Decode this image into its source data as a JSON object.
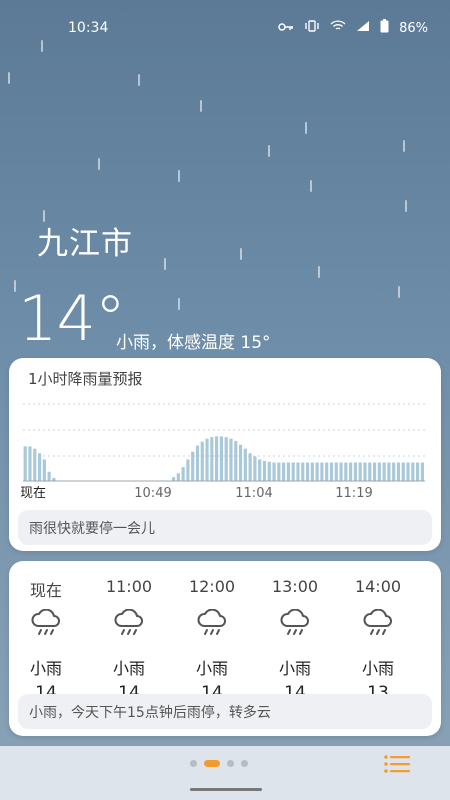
{
  "status_bar": {
    "time": "10:34",
    "battery": "86%",
    "icons": [
      "key-icon",
      "vibrate-icon",
      "wifi-icon",
      "signal-icon",
      "battery-icon"
    ]
  },
  "location": {
    "city": "九江市"
  },
  "current": {
    "temperature": "14°",
    "summary": "小雨，体感温度 15°"
  },
  "precip_card": {
    "title": "1小时降雨量预报",
    "time_labels": [
      "现在",
      "10:49",
      "11:04",
      "11:19"
    ],
    "note": "雨很快就要停一会儿",
    "chart_data": {
      "type": "bar",
      "title": "1小时降雨量预报",
      "x": [
        "现在",
        "10:49",
        "11:04",
        "11:19"
      ],
      "values": [
        0.45,
        0.45,
        0.42,
        0.36,
        0.28,
        0.12,
        0.04,
        0,
        0,
        0,
        0,
        0,
        0,
        0,
        0,
        0,
        0,
        0,
        0,
        0,
        0,
        0,
        0,
        0,
        0,
        0,
        0,
        0,
        0,
        0,
        0,
        0.05,
        0.1,
        0.18,
        0.28,
        0.38,
        0.46,
        0.51,
        0.55,
        0.57,
        0.58,
        0.58,
        0.57,
        0.55,
        0.52,
        0.47,
        0.42,
        0.36,
        0.32,
        0.28,
        0.26,
        0.25,
        0.24,
        0.24,
        0.24,
        0.24,
        0.24,
        0.24,
        0.24,
        0.24,
        0.24,
        0.24,
        0.24,
        0.24,
        0.24,
        0.24,
        0.24,
        0.24,
        0.24,
        0.24,
        0.24,
        0.24,
        0.24,
        0.24,
        0.24,
        0.24,
        0.24,
        0.24,
        0.24,
        0.24,
        0.24,
        0.24,
        0.24,
        0.24
      ],
      "ylim": [
        0,
        1
      ],
      "grid": true,
      "bar_color": "#a9c9d8"
    }
  },
  "hourly_card": {
    "hours": [
      {
        "time": "现在",
        "icon": "light-rain-icon",
        "condition": "小雨",
        "temp": "14"
      },
      {
        "time": "11:00",
        "icon": "light-rain-icon",
        "condition": "小雨",
        "temp": "14"
      },
      {
        "time": "12:00",
        "icon": "light-rain-icon",
        "condition": "小雨",
        "temp": "14"
      },
      {
        "time": "13:00",
        "icon": "light-rain-icon",
        "condition": "小雨",
        "temp": "14"
      },
      {
        "time": "14:00",
        "icon": "light-rain-icon",
        "condition": "小雨",
        "temp": "13"
      }
    ],
    "note": "小雨，今天下午15点钟后雨停，转多云"
  },
  "bottom": {
    "pager_active_index": 1,
    "pager_count": 4,
    "accent_color": "#f39b2f"
  }
}
